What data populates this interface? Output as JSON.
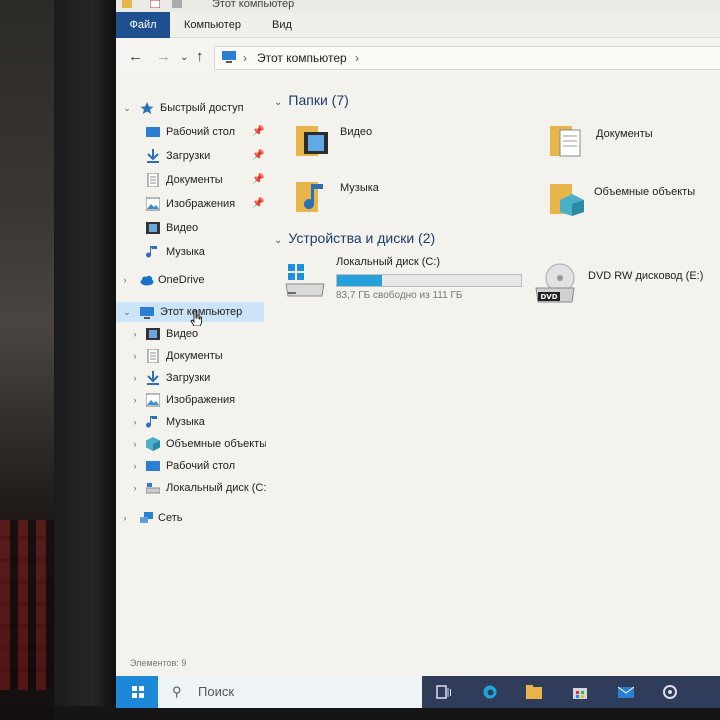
{
  "window": {
    "title": "Этот компьютер"
  },
  "ribbon": {
    "tabs": [
      "Файл",
      "Компьютер",
      "Вид"
    ]
  },
  "address": {
    "path": "Этот компьютер"
  },
  "sidebar": {
    "quick_access": {
      "label": "Быстрый доступ",
      "items": [
        {
          "label": "Рабочий стол",
          "icon": "desktop-icon",
          "pinned": true
        },
        {
          "label": "Загрузки",
          "icon": "downloads-icon",
          "pinned": true
        },
        {
          "label": "Документы",
          "icon": "documents-icon",
          "pinned": true
        },
        {
          "label": "Изображения",
          "icon": "pictures-icon",
          "pinned": true
        },
        {
          "label": "Видео",
          "icon": "video-icon",
          "pinned": false
        },
        {
          "label": "Музыка",
          "icon": "music-icon",
          "pinned": false
        }
      ]
    },
    "onedrive": {
      "label": "OneDrive"
    },
    "this_pc": {
      "label": "Этот компьютер",
      "children": [
        {
          "label": "Видео"
        },
        {
          "label": "Документы"
        },
        {
          "label": "Загрузки"
        },
        {
          "label": "Изображения"
        },
        {
          "label": "Музыка"
        },
        {
          "label": "Объемные объекты"
        },
        {
          "label": "Рабочий стол"
        },
        {
          "label": "Локальный диск (C:)"
        }
      ]
    },
    "network": {
      "label": "Сеть"
    }
  },
  "main": {
    "folders_group": {
      "header": "Папки (7)",
      "items": [
        {
          "label": "Видео",
          "icon": "video-folder-icon"
        },
        {
          "label": "Документы",
          "icon": "documents-folder-icon"
        },
        {
          "label": "Музыка",
          "icon": "music-folder-icon"
        },
        {
          "label": "Объемные объекты",
          "icon": "3d-objects-folder-icon"
        }
      ]
    },
    "devices_group": {
      "header": "Устройства и диски (2)",
      "items": [
        {
          "label": "Локальный диск (C:)",
          "sub": "83,7 ГБ свободно из 111 ГБ",
          "used_fraction": 0.246,
          "icon": "hard-drive-icon"
        },
        {
          "label": "DVD RW дисковод (E:)",
          "icon": "dvd-drive-icon",
          "badge": "DVD"
        }
      ]
    }
  },
  "status": {
    "items_count": "Элементов: 9"
  },
  "taskbar": {
    "search_placeholder": "Поиск"
  },
  "colors": {
    "accent": "#1f4f8f",
    "selection": "#cce4f7",
    "drive_fill": "#26a0da",
    "folder": "#e8b54a",
    "taskbar": "#2f3c5a",
    "start": "#1e88d8"
  }
}
